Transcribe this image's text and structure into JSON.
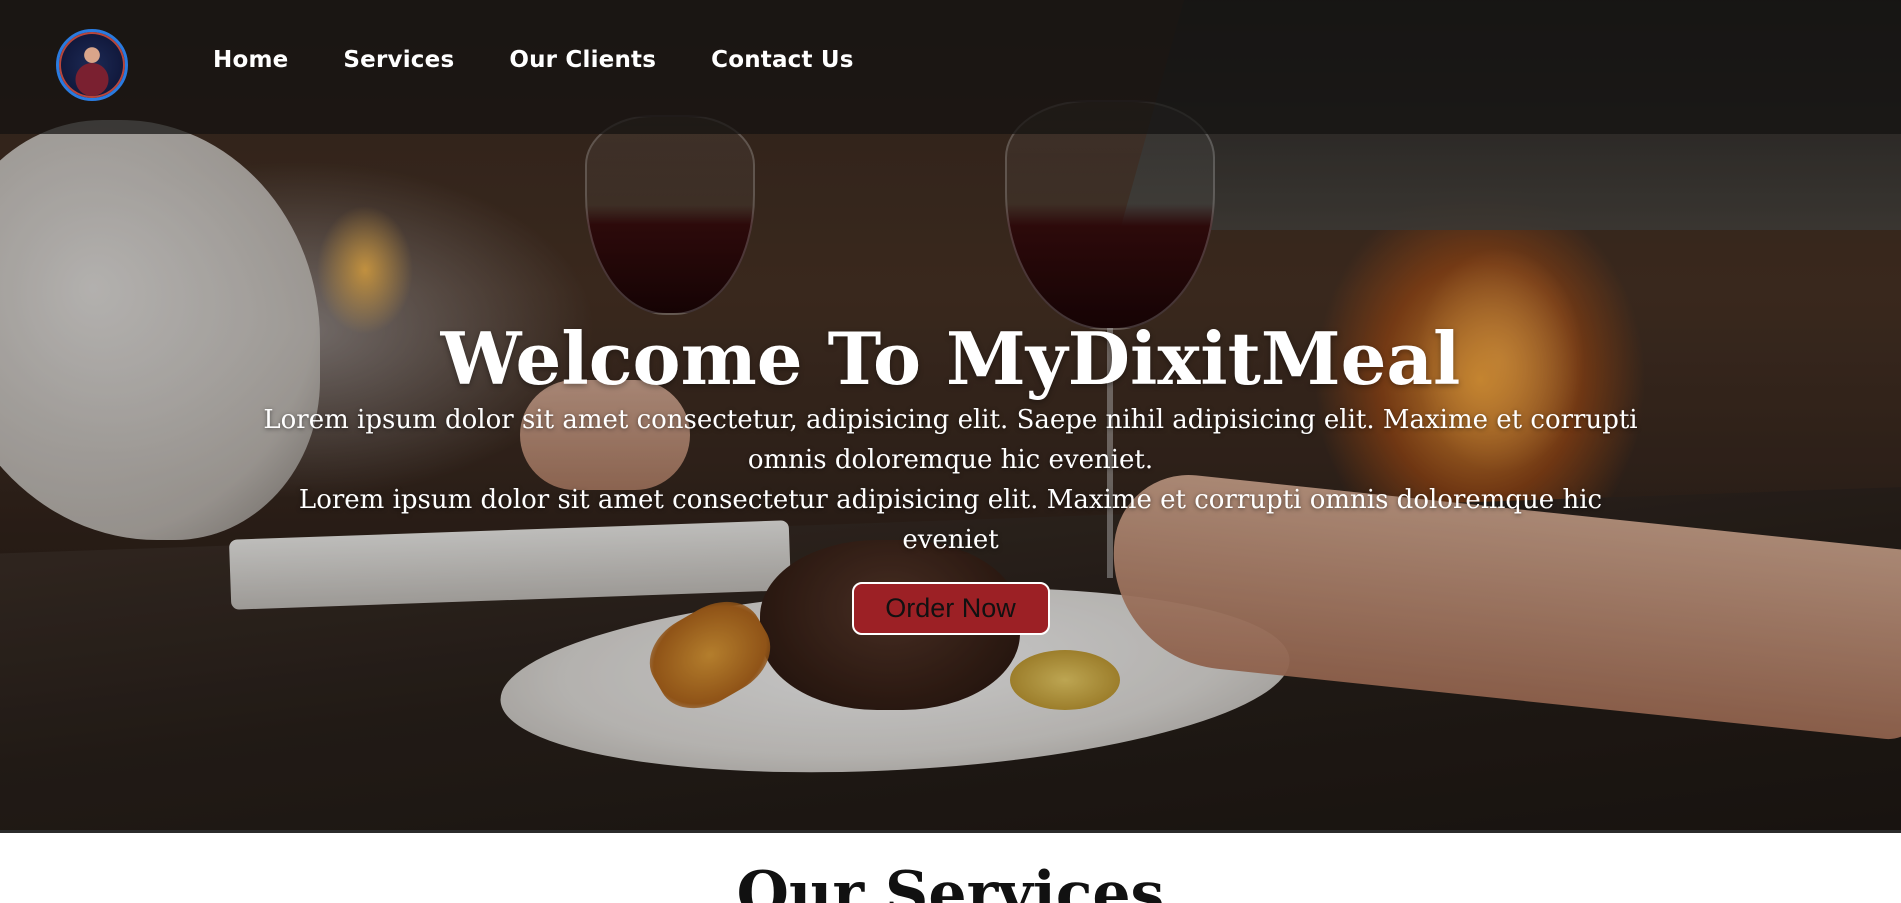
{
  "nav": {
    "logo_alt": "profile avatar",
    "links": [
      {
        "label": "Home"
      },
      {
        "label": "Services"
      },
      {
        "label": "Our Clients"
      },
      {
        "label": "Contact Us"
      }
    ]
  },
  "hero": {
    "title": "Welcome To MyDixitMeal",
    "paragraph_1": "Lorem ipsum dolor sit amet consectetur, adipisicing elit. Saepe nihil adipisicing elit. Maxime et corrupti omnis doloremque hic eveniet.",
    "paragraph_2": "Lorem ipsum dolor sit amet consectetur adipisicing elit. Maxime et corrupti omnis doloremque hic eveniet",
    "button_label": "Order Now",
    "button_color": "#9c2025"
  },
  "services": {
    "title": "Our Services"
  }
}
